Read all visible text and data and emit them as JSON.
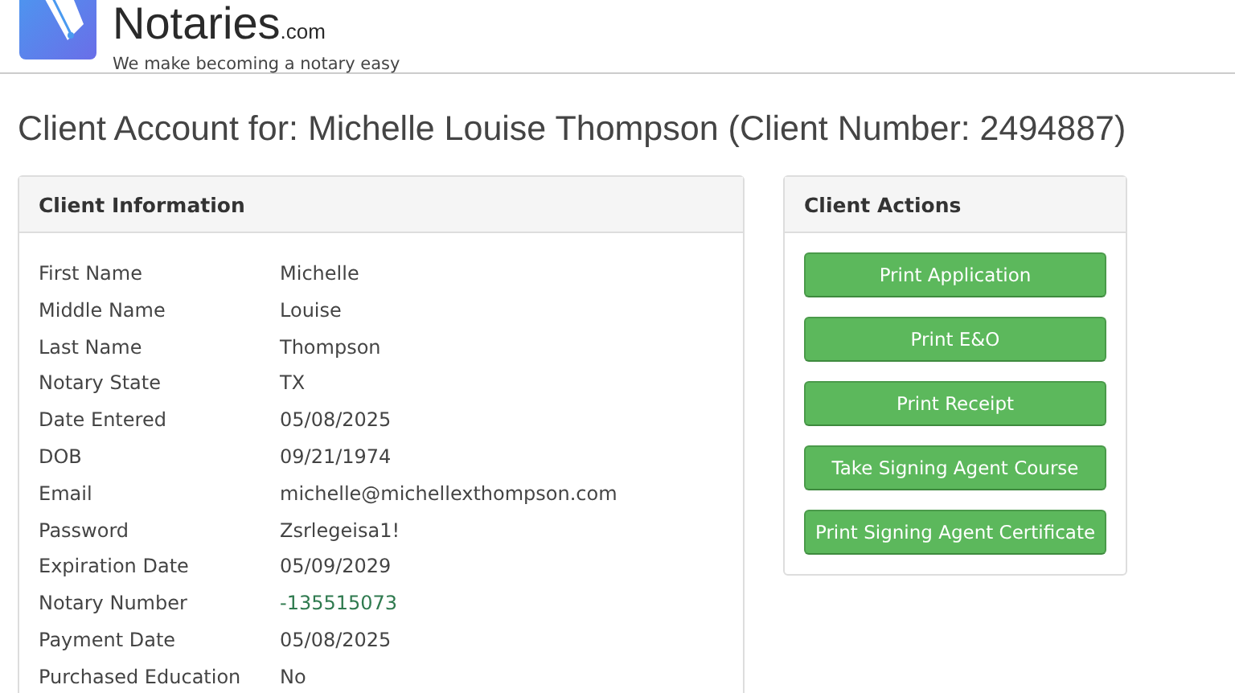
{
  "header": {
    "brand": "Notaries",
    "brand_suffix": ".com",
    "tagline": "We make becoming a notary easy"
  },
  "page_title": "Client Account for: Michelle Louise Thompson (Client Number: 2494887)",
  "client_information": {
    "title": "Client Information",
    "rows": [
      {
        "label": "First Name",
        "value": "Michelle",
        "kind": "text"
      },
      {
        "label": "Middle Name",
        "value": "Louise",
        "kind": "text"
      },
      {
        "label": "Last Name",
        "value": "Thompson",
        "kind": "text"
      },
      {
        "label": "Notary State",
        "value": "TX",
        "kind": "text"
      },
      {
        "label": "Date Entered",
        "value": "05/08/2025",
        "kind": "text"
      },
      {
        "label": "DOB",
        "value": "09/21/1974",
        "kind": "text"
      },
      {
        "label": "Email",
        "value": "michelle@michellexthompson.com",
        "kind": "text"
      },
      {
        "label": "Password",
        "value": "Zsrlegeisa1!",
        "kind": "text"
      },
      {
        "label": "Expiration Date",
        "value": "05/09/2029",
        "kind": "text"
      },
      {
        "label": "Notary Number",
        "value": "-135515073",
        "kind": "highlight"
      },
      {
        "label": "Payment Date",
        "value": "05/08/2025",
        "kind": "text"
      },
      {
        "label": "Purchased Education",
        "value": "No",
        "kind": "text"
      }
    ]
  },
  "client_actions": {
    "title": "Client Actions",
    "buttons": [
      "Print Application",
      "Print E&O",
      "Print Receipt",
      "Take Signing Agent Course",
      "Print Signing Agent Certificate"
    ]
  }
}
